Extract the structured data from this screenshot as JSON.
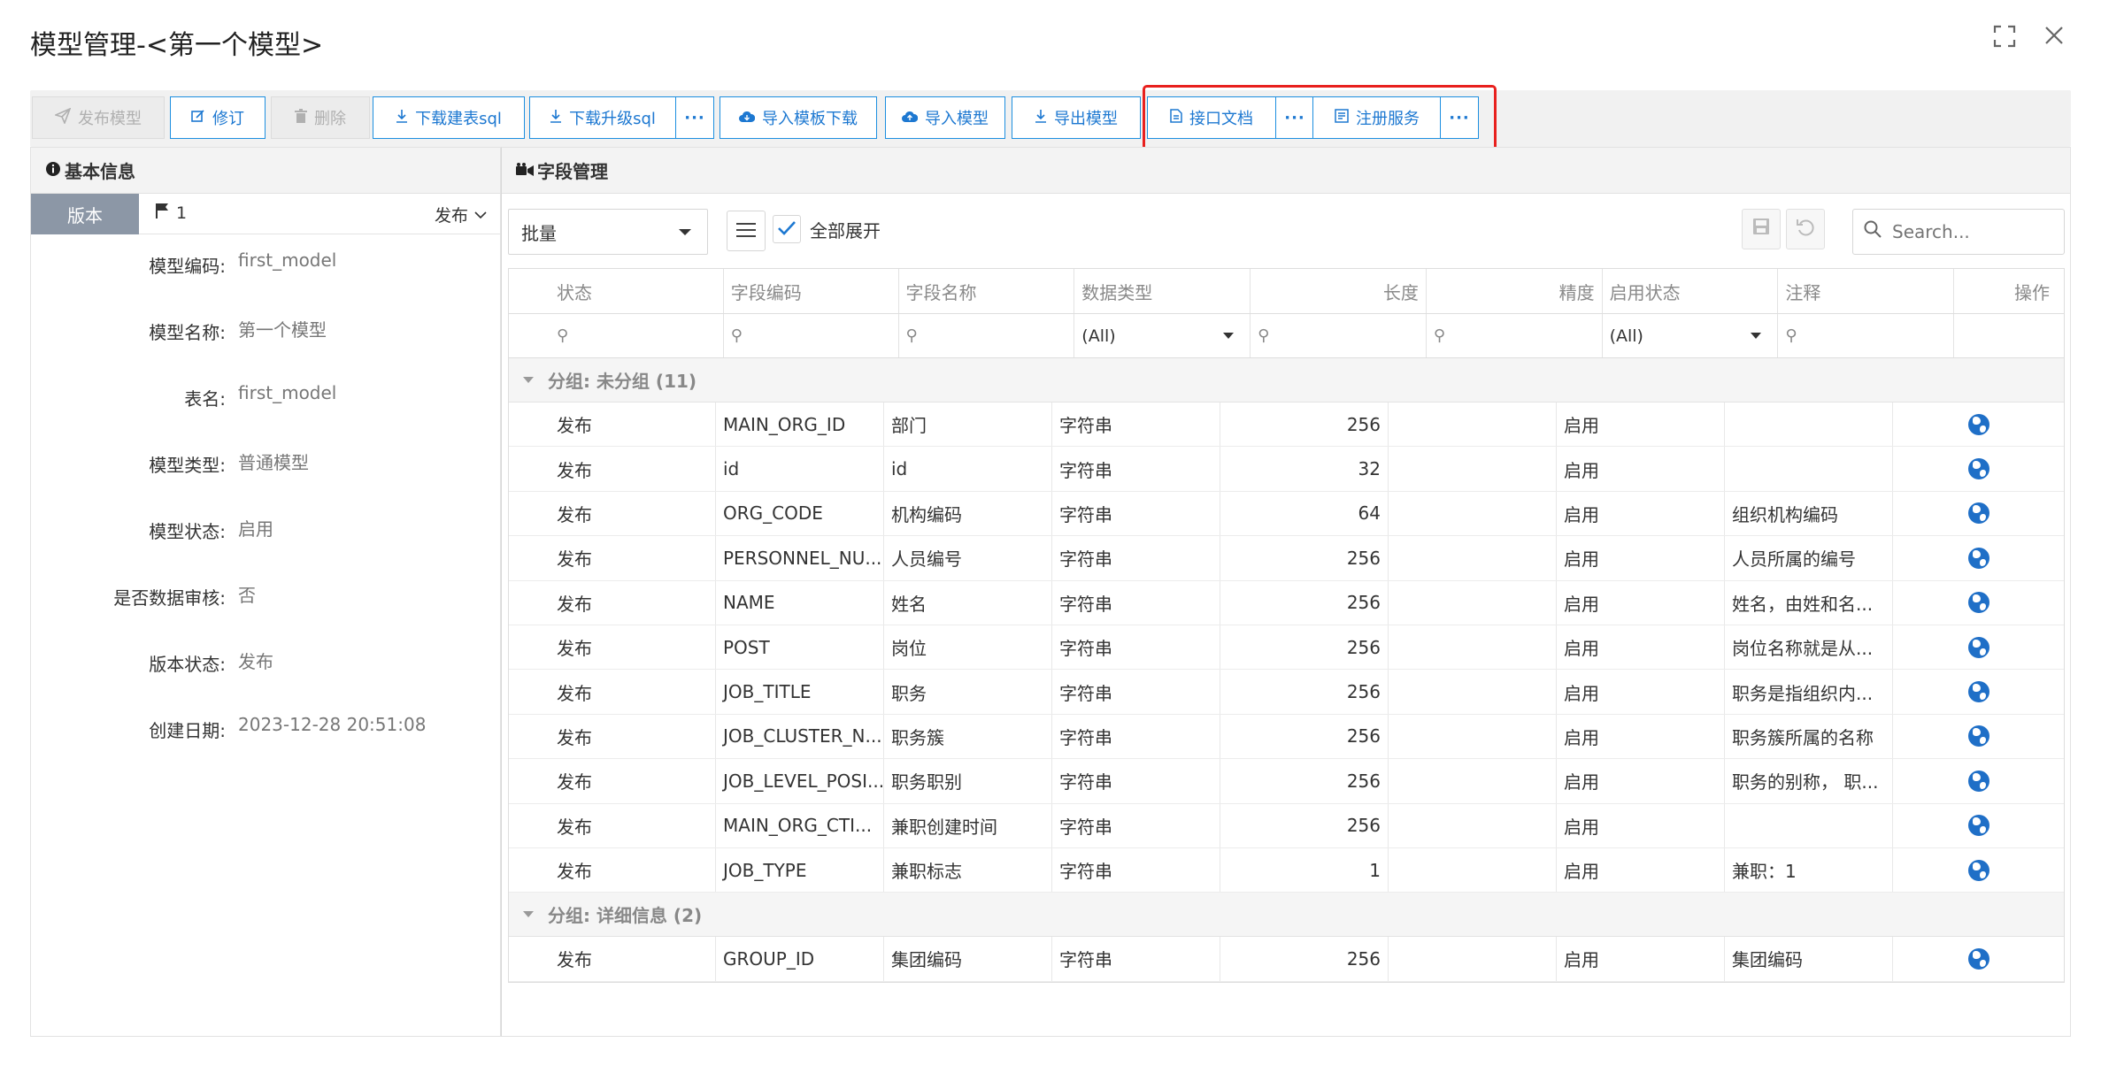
{
  "window": {
    "title": "模型管理-<第一个模型>",
    "maximize_icon": "maximize-icon",
    "close_icon": "close-icon"
  },
  "toolbar": {
    "publish": "发布模型",
    "revise": "修订",
    "delete": "删除",
    "download_create_sql": "下载建表sql",
    "download_upgrade_sql": "下载升级sql",
    "more": "···",
    "import_template": "导入模板下载",
    "import_model": "导入模型",
    "export_model": "导出模型",
    "api_doc": "接口文档",
    "register_service": "注册服务"
  },
  "left": {
    "header": "基本信息",
    "version_tab": "版本",
    "version_number": "1",
    "version_status": "发布",
    "fields": [
      {
        "label": "模型编码:",
        "value": "first_model"
      },
      {
        "label": "模型名称:",
        "value": "第一个模型"
      },
      {
        "label": "表名:",
        "value": "first_model"
      },
      {
        "label": "模型类型:",
        "value": "普通模型"
      },
      {
        "label": "模型状态:",
        "value": "启用"
      },
      {
        "label": "是否数据审核:",
        "value": "否"
      },
      {
        "label": "版本状态:",
        "value": "发布"
      },
      {
        "label": "创建日期:",
        "value": "2023-12-28 20:51:08"
      }
    ]
  },
  "right": {
    "header": "字段管理",
    "batch": "批量",
    "expand_all": "全部展开",
    "search_placeholder": "Search...",
    "columns": [
      "状态",
      "字段编码",
      "字段名称",
      "数据类型",
      "长度",
      "精度",
      "启用状态",
      "注释",
      "操作"
    ],
    "filter_all_type": "(All)",
    "filter_all_enabled": "(All)",
    "groups": [
      {
        "label": "分组: 未分组 (11)",
        "rows": [
          {
            "status": "发布",
            "code": "MAIN_ORG_ID",
            "name": "部门",
            "type": "字符串",
            "length": "256",
            "precision": "",
            "enabled": "启用",
            "note": ""
          },
          {
            "status": "发布",
            "code": "id",
            "name": "id",
            "type": "字符串",
            "length": "32",
            "precision": "",
            "enabled": "启用",
            "note": ""
          },
          {
            "status": "发布",
            "code": "ORG_CODE",
            "name": "机构编码",
            "type": "字符串",
            "length": "64",
            "precision": "",
            "enabled": "启用",
            "note": "组织机构编码"
          },
          {
            "status": "发布",
            "code": "PERSONNEL_NU...",
            "name": "人员编号",
            "type": "字符串",
            "length": "256",
            "precision": "",
            "enabled": "启用",
            "note": "人员所属的编号"
          },
          {
            "status": "发布",
            "code": "NAME",
            "name": "姓名",
            "type": "字符串",
            "length": "256",
            "precision": "",
            "enabled": "启用",
            "note": "姓名，由姓和名..."
          },
          {
            "status": "发布",
            "code": "POST",
            "name": "岗位",
            "type": "字符串",
            "length": "256",
            "precision": "",
            "enabled": "启用",
            "note": "岗位名称就是从..."
          },
          {
            "status": "发布",
            "code": "JOB_TITLE",
            "name": "职务",
            "type": "字符串",
            "length": "256",
            "precision": "",
            "enabled": "启用",
            "note": "职务是指组织内..."
          },
          {
            "status": "发布",
            "code": "JOB_CLUSTER_N...",
            "name": "职务簇",
            "type": "字符串",
            "length": "256",
            "precision": "",
            "enabled": "启用",
            "note": "职务簇所属的名称"
          },
          {
            "status": "发布",
            "code": "JOB_LEVEL_POSI...",
            "name": "职务职别",
            "type": "字符串",
            "length": "256",
            "precision": "",
            "enabled": "启用",
            "note": "职务的别称， 职..."
          },
          {
            "status": "发布",
            "code": "MAIN_ORG_CTI...",
            "name": "兼职创建时间",
            "type": "字符串",
            "length": "256",
            "precision": "",
            "enabled": "启用",
            "note": ""
          },
          {
            "status": "发布",
            "code": "JOB_TYPE",
            "name": "兼职标志",
            "type": "字符串",
            "length": "1",
            "precision": "",
            "enabled": "启用",
            "note": "兼职：1"
          }
        ]
      },
      {
        "label": "分组: 详细信息 (2)",
        "rows": [
          {
            "status": "发布",
            "code": "GROUP_ID",
            "name": "集团编码",
            "type": "字符串",
            "length": "256",
            "precision": "",
            "enabled": "启用",
            "note": "集团编码"
          }
        ]
      }
    ]
  },
  "colors": {
    "accent": "#1d78d1",
    "highlight_border": "#e8201e",
    "version_tab_bg": "#8c97a6"
  }
}
